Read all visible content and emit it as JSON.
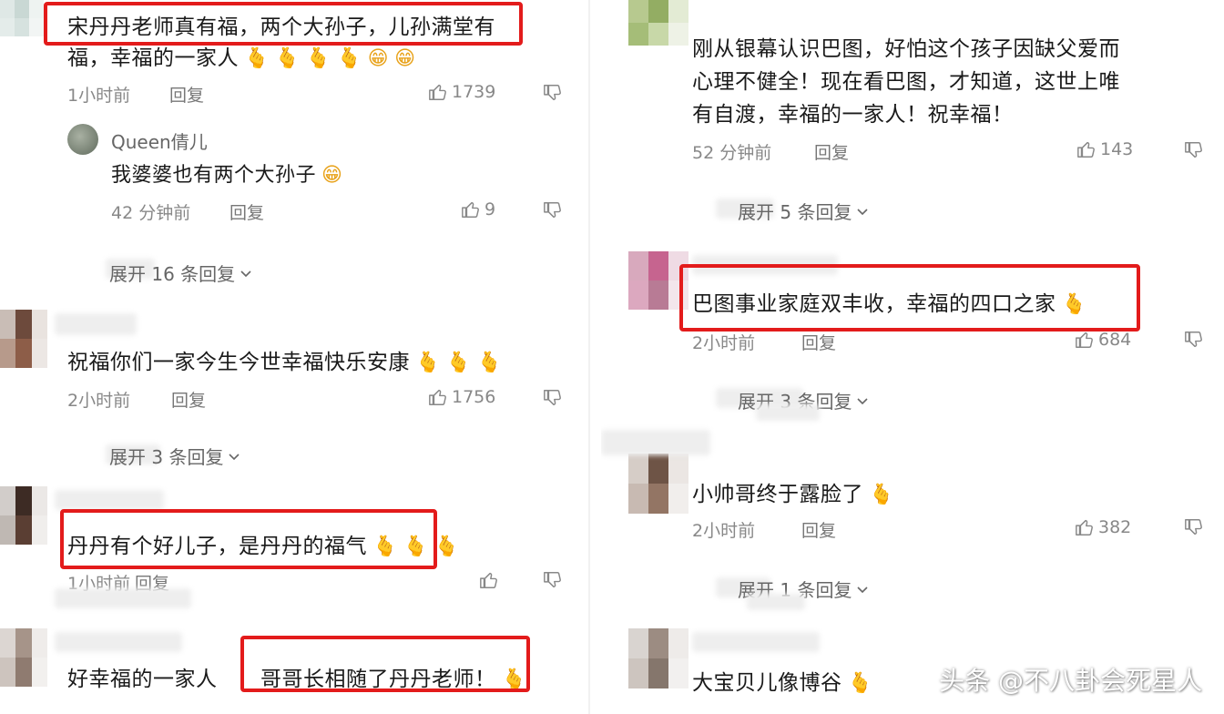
{
  "left": {
    "c1": {
      "text_line1": "宋丹丹老师真有福，两个大孙子，儿孙满堂有",
      "text_line2": "福，幸福的一家人",
      "time": "1小时前",
      "reply": "回复",
      "likes": "1739"
    },
    "c1_reply": {
      "username": "Queen倩儿",
      "text": "我婆婆也有两个大孙子",
      "time": "42 分钟前",
      "reply": "回复",
      "likes": "9"
    },
    "c1_expand": "展开 16 条回复",
    "c2": {
      "text": "祝福你们一家今生今世幸福快乐安康",
      "time": "2小时前",
      "reply": "回复",
      "likes": "1756"
    },
    "c2_expand": "展开 3 条回复",
    "c3": {
      "text": "丹丹有个好儿子，是丹丹的福气",
      "time": "1小时前",
      "reply": "回复"
    },
    "c4": {
      "text_a": "好幸福的一家人",
      "text_b": "哥哥长相随了丹丹老师！"
    }
  },
  "right": {
    "c1": {
      "text_line1": "刚从银幕认识巴图，好怕这个孩子因缺父爱而",
      "text_line2": "心理不健全！现在看巴图，才知道，这世上唯",
      "text_line3": "有自渡，幸福的一家人！祝幸福！",
      "time": "52 分钟前",
      "reply": "回复",
      "likes": "143"
    },
    "c1_expand": "展开 5 条回复",
    "c2": {
      "text": "巴图事业家庭双丰收，幸福的四口之家",
      "time": "2小时前",
      "reply": "回复",
      "likes": "684"
    },
    "c2_expand": "展开 3 条回复",
    "c3": {
      "text": "小帅哥终于露脸了",
      "time": "2小时前",
      "reply": "回复",
      "likes": "382"
    },
    "c3_expand": "展开 1 条回复",
    "c4": {
      "text": "大宝贝儿像博谷"
    }
  },
  "watermark": "头条 @不八卦会死星人",
  "icons": {
    "like": "thumbs-up-icon",
    "dislike": "thumbs-down-icon",
    "expand": "chevron-down-icon",
    "emoji_heart": "heart-hand-emoji",
    "emoji_smile": "grin-emoji"
  },
  "colors": {
    "highlight": "#e31b1b",
    "meta": "#888888",
    "text": "#1a1a1a"
  }
}
